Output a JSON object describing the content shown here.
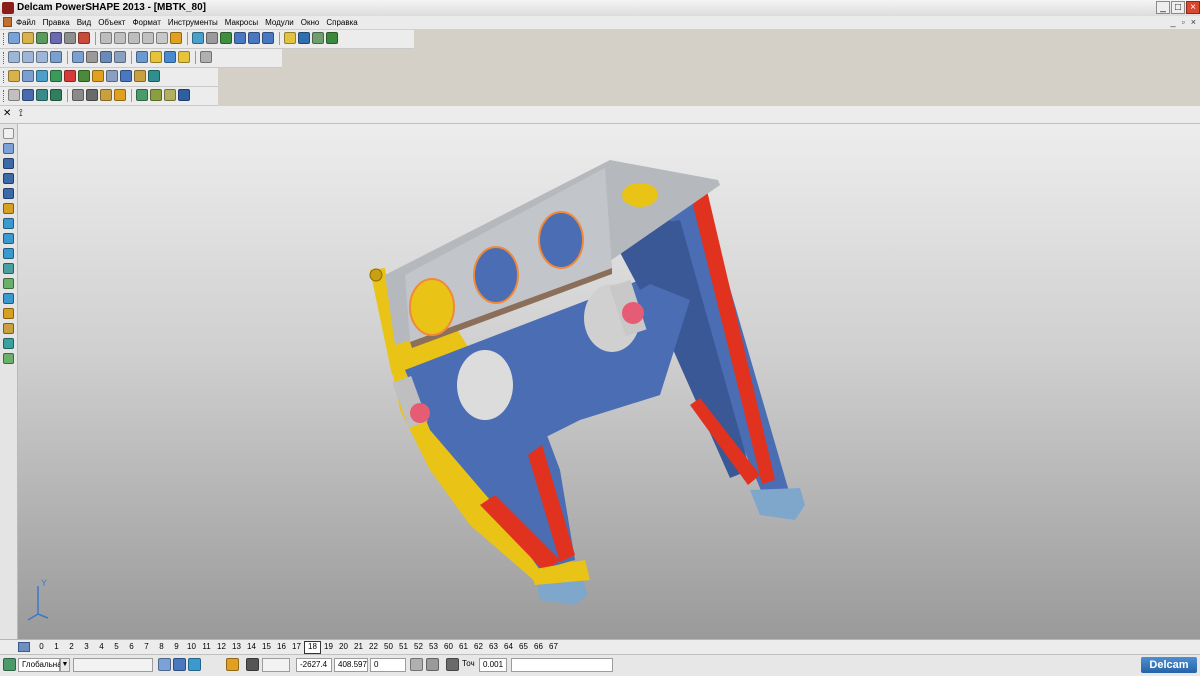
{
  "window": {
    "title": "Delcam PowerSHAPE 2013 - [MBTK_80]",
    "controls": [
      "_",
      "□",
      "×"
    ]
  },
  "menu": {
    "items": [
      "Файл",
      "Правка",
      "Вид",
      "Объект",
      "Формат",
      "Инструменты",
      "Макросы",
      "Модули",
      "Окно",
      "Справка"
    ],
    "doc_controls": [
      "_",
      "▫",
      "×"
    ]
  },
  "toolbars": {
    "row1_colors": [
      "#7aa1d8",
      "#d8b24a",
      "#5c9a5c",
      "#6a6ab0",
      "#8f8f8f",
      "#c94a3a",
      "#bdbdbd",
      "#c0c0c0",
      "#bdbdbd",
      "#c0c0c0",
      "#c7c7c7",
      "#e0a020",
      "#4aa0c8",
      "#9a9a9a",
      "#3f8f3f",
      "#4a78c0",
      "#4a78c0",
      "#4a78c0",
      "#e2c240",
      "#2f6fb0",
      "#6f9f6f",
      "#3c8a3c"
    ],
    "row2_colors": [
      "#9db6d8",
      "#9db6d8",
      "#9db6d8",
      "#7a9fd0",
      "#7a9fd0",
      "#9a9a9a",
      "#6a8ab8",
      "#8aa0c0",
      "#6a9ad0",
      "#e7c33a",
      "#4a8ad0",
      "#e7c33a",
      "#b0b0b0"
    ],
    "row3_colors": [
      "#d8b24a",
      "#7a9fd0",
      "#4aa0c8",
      "#3a9a5a",
      "#d83a3a",
      "#4a8a3a",
      "#e0a020",
      "#8aa0c0",
      "#4a78c0",
      "#c9a040",
      "#2f8f8f"
    ],
    "row4_colors": [
      "#c0c0c0",
      "#4a6ab0",
      "#3a8a8a",
      "#2f7f5f",
      "#8a8a8a",
      "#6a6a6a",
      "#c9a040",
      "#e0a020",
      "#4a9a6a",
      "#8aa040",
      "#b0b060",
      "#2f5fa0"
    ]
  },
  "left_toolbar": {
    "colors": [
      "#f0f0f0",
      "#7aa1d8",
      "#3a6aa8",
      "#3a6aa8",
      "#3a6aa8",
      "#d8a020",
      "#3a9ad0",
      "#3a9ad0",
      "#3a9ad0",
      "#4aa0a0",
      "#6ab06a",
      "#3a9ad0",
      "#d8a020",
      "#c9a040",
      "#3aa0a0",
      "#6ab06a"
    ]
  },
  "viewport": {
    "model_name": "MBTK_80",
    "colors": {
      "plate": "#b5b9bd",
      "blue": "#4b6db3",
      "blue_dark": "#3a5896",
      "yellow": "#e9c316",
      "red": "#e0321e",
      "pink": "#e65c74",
      "foot": "#7fa7cc",
      "hole_rim": "#f08a3a"
    },
    "axis_label": "Y"
  },
  "levels": {
    "items": [
      "0",
      "1",
      "2",
      "3",
      "4",
      "5",
      "6",
      "7",
      "8",
      "9",
      "10",
      "11",
      "12",
      "13",
      "14",
      "15",
      "16",
      "17",
      "18",
      "19",
      "20",
      "21",
      "22",
      "50",
      "51",
      "52",
      "53",
      "60",
      "61",
      "62",
      "63",
      "64",
      "65",
      "66",
      "67"
    ],
    "active": "18"
  },
  "status": {
    "workplane": "Глобальная",
    "x": "-2627.4",
    "y": "408.597",
    "z": "0",
    "tolerance_label": "Точ",
    "tolerance": "0.001",
    "brand": "Delcam"
  }
}
